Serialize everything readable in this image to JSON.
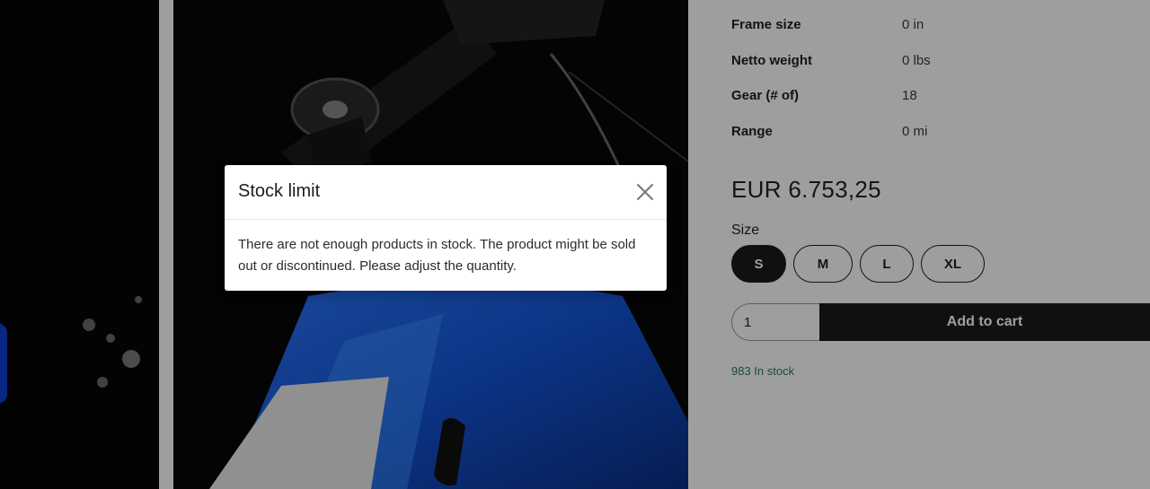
{
  "product": {
    "specs": [
      {
        "label": "Frame size",
        "value": "0 in"
      },
      {
        "label": "Netto weight",
        "value": "0 lbs"
      },
      {
        "label": "Gear (# of)",
        "value": "18"
      },
      {
        "label": "Range",
        "value": "0 mi"
      }
    ],
    "price": "EUR 6.753,25",
    "size_label": "Size",
    "sizes": [
      "S",
      "M",
      "L",
      "XL"
    ],
    "selected_size": "S",
    "quantity": "1",
    "add_to_cart_label": "Add to cart",
    "stock_status": "983 In stock"
  },
  "modal": {
    "title": "Stock limit",
    "message": "There are not enough products in stock. The product might be sold out or discontinued. Please adjust the quantity."
  },
  "icons": {
    "close": "close-icon"
  },
  "colors": {
    "primary": "#1b1b1b",
    "stock_green": "#2e7d4f",
    "frame_blue": "#1a5fd0"
  }
}
